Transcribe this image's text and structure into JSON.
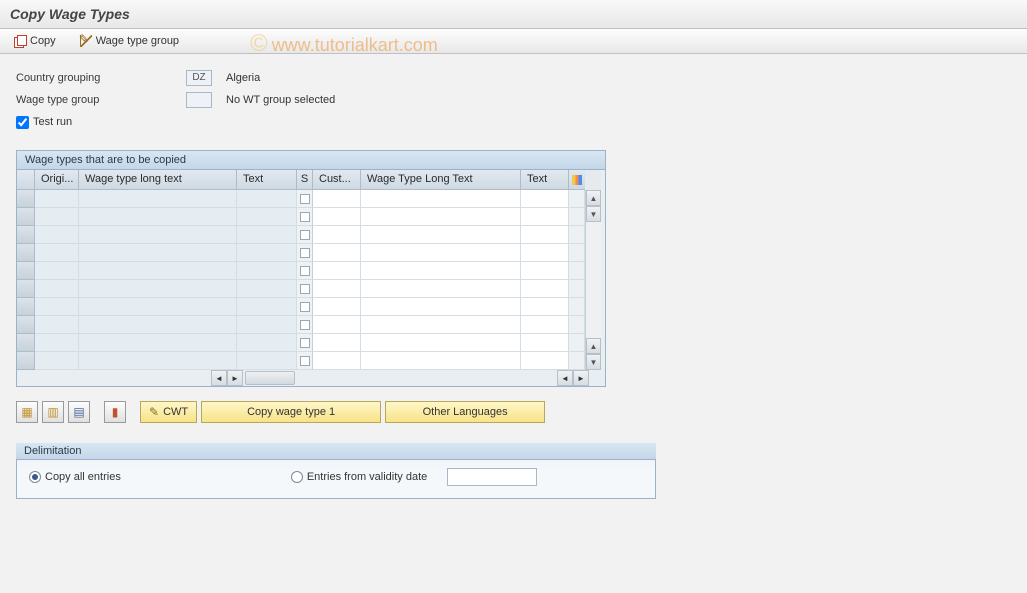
{
  "title": "Copy Wage Types",
  "toolbar": {
    "copy_label": "Copy",
    "wtg_label": "Wage type group"
  },
  "watermark": {
    "c": "©",
    "text": "www.tutorialkart.com"
  },
  "form": {
    "country_label": "Country grouping",
    "country_code": "DZ",
    "country_name": "Algeria",
    "wtg_label": "Wage type group",
    "wtg_value": "",
    "wtg_desc": "No WT group selected",
    "testrun_label": "Test run",
    "testrun_checked": true
  },
  "table": {
    "title": "Wage types that are to be copied",
    "cols_left": {
      "origi": "Origi...",
      "longtext": "Wage type long text",
      "text": "Text"
    },
    "cols_right": {
      "s": "S",
      "cust": "Cust...",
      "longtext": "Wage Type Long Text",
      "text": "Text"
    },
    "row_count": 10
  },
  "buttons": {
    "cwt": "CWT",
    "copy1": "Copy wage type 1",
    "otherlang": "Other Languages"
  },
  "delimitation": {
    "title": "Delimitation",
    "copy_all": "Copy all entries",
    "from_date": "Entries from validity date",
    "date_value": ""
  }
}
